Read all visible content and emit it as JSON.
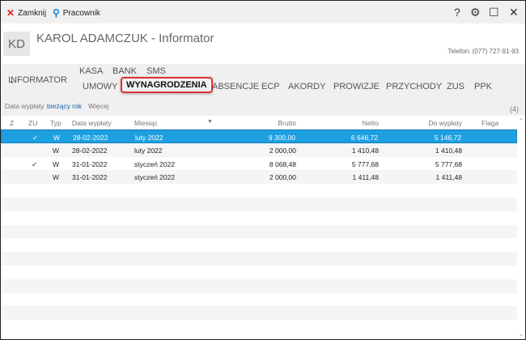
{
  "topbar": {
    "close_label": "Zamknij",
    "employee_label": "Pracownik"
  },
  "header": {
    "initials": "KD",
    "title": "KAROL ADAMCZUK - Informator",
    "phone": "Telefon: (077) 727-91-93"
  },
  "nav": {
    "informator": "INFORMATOR",
    "top": [
      "KASA",
      "BANK",
      "SMS"
    ],
    "tabs": [
      "UMOWY",
      "WYNAGRODZENIA",
      "ABSENCJE",
      "ECP",
      "AKORDY",
      "PROWIZJE",
      "PRZYCHODY",
      "ZUS",
      "PPK"
    ],
    "active": "WYNAGRODZENIA"
  },
  "filter": {
    "label": "Data wypłaty",
    "value": "bieżący rok",
    "more": "Więcej",
    "count": "(4)"
  },
  "table": {
    "columns": [
      "Z",
      "ZU",
      "Typ",
      "Data wypłaty",
      "Miesiąc",
      "Brutto",
      "Netto",
      "Do wypłaty",
      "Flaga"
    ],
    "rows": [
      {
        "z": "",
        "zu": "✓",
        "typ": "W",
        "date": "28-02-2022",
        "month": "luty 2022",
        "brutto": "9 300,00",
        "netto": "6 646,72",
        "dowyplaty": "5 146,72",
        "flaga": ""
      },
      {
        "z": "",
        "zu": "",
        "typ": "W",
        "date": "28-02-2022",
        "month": "luty 2022",
        "brutto": "2 000,00",
        "netto": "1 410,48",
        "dowyplaty": "1 410,48",
        "flaga": ""
      },
      {
        "z": "",
        "zu": "✓",
        "typ": "W",
        "date": "31-01-2022",
        "month": "styczeń 2022",
        "brutto": "8 068,48",
        "netto": "5 777,68",
        "dowyplaty": "5 777,68",
        "flaga": ""
      },
      {
        "z": "",
        "zu": "",
        "typ": "W",
        "date": "31-01-2022",
        "month": "styczeń 2022",
        "brutto": "2 000,00",
        "netto": "1 411,48",
        "dowyplaty": "1 411,48",
        "flaga": ""
      }
    ]
  },
  "colors": {
    "selected": "#1ea0e0",
    "active_outline": "#e03030",
    "link": "#1a5fb4"
  }
}
